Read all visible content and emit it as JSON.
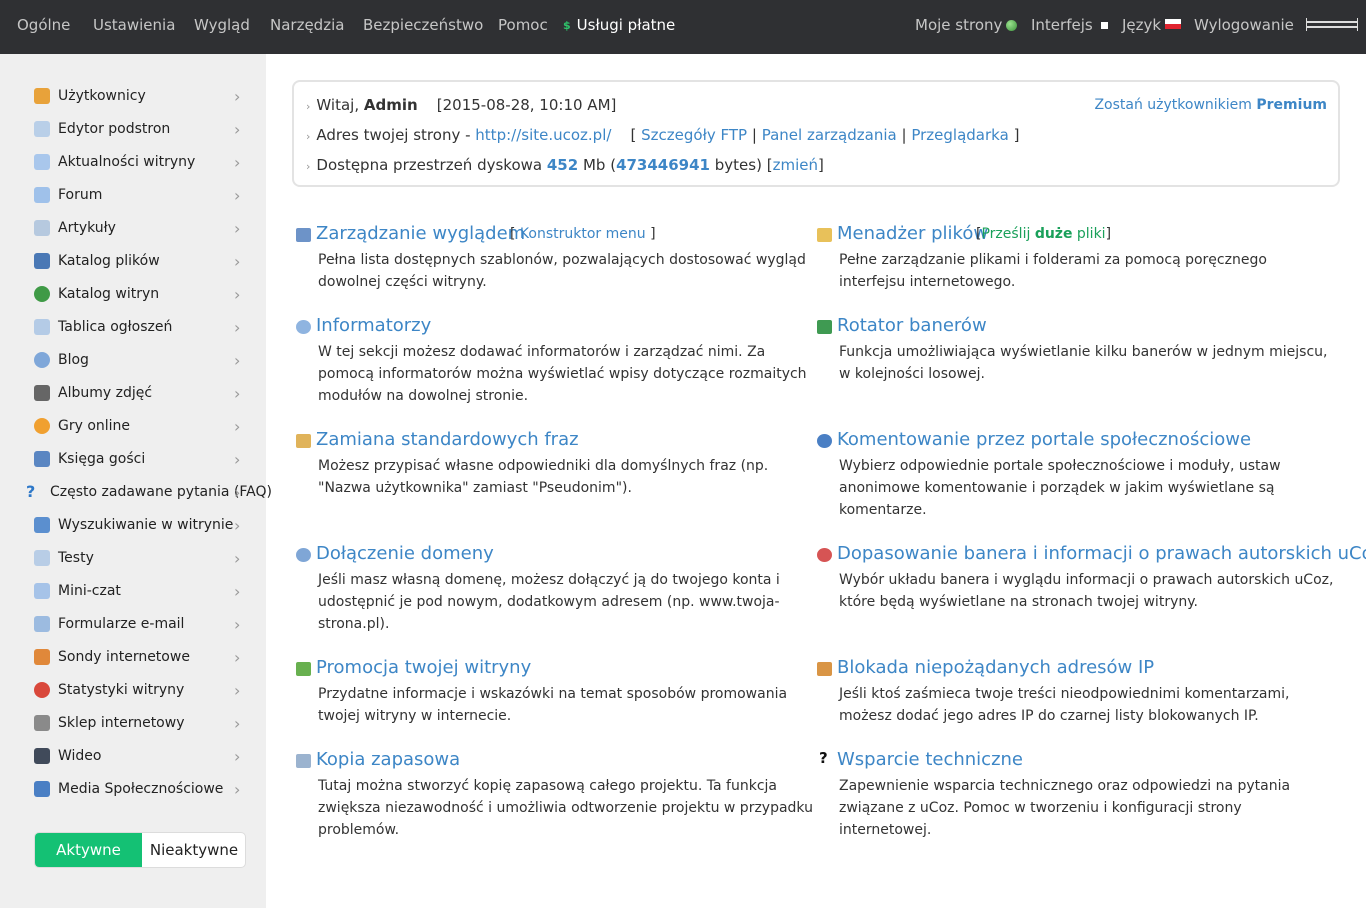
{
  "topnav": {
    "left": [
      "Ogólne",
      "Ustawienia",
      "Wygląd",
      "Narzędzia",
      "Bezpieczeństwo",
      "Pomoc"
    ],
    "paid": "Usługi płatne",
    "paid_icon": "$",
    "right": {
      "my_sites": "Moje strony",
      "interface": "Interfejs",
      "language": "Język",
      "logout": "Wylogowanie"
    }
  },
  "sidebar": {
    "items": [
      {
        "label": "Użytkownicy",
        "icon": "user-icon",
        "color": "#e8a23a"
      },
      {
        "label": "Edytor podstron",
        "icon": "page-icon",
        "color": "#b9cfe8"
      },
      {
        "label": "Aktualności witryny",
        "icon": "bulb-icon",
        "color": "#a9c7ec"
      },
      {
        "label": "Forum",
        "icon": "chat-icon",
        "color": "#9fc1ea"
      },
      {
        "label": "Artykuły",
        "icon": "article-icon",
        "color": "#b6c9df"
      },
      {
        "label": "Katalog plików",
        "icon": "floppy-icon",
        "color": "#4a78b5"
      },
      {
        "label": "Katalog witryn",
        "icon": "globe-icon",
        "color": "#3f9a46"
      },
      {
        "label": "Tablica ogłoszeń",
        "icon": "board-icon",
        "color": "#b4cbe6"
      },
      {
        "label": "Blog",
        "icon": "blog-icon",
        "color": "#7fa7d9"
      },
      {
        "label": "Albumy zdjęć",
        "icon": "camera-icon",
        "color": "#666666"
      },
      {
        "label": "Gry online",
        "icon": "game-icon",
        "color": "#f0a030"
      },
      {
        "label": "Księga gości",
        "icon": "book-icon",
        "color": "#5a86c2"
      },
      {
        "label": "Często zadawane pytania (FAQ)",
        "icon": "question-icon",
        "color": "#2e78c8"
      },
      {
        "label": "Wyszukiwanie w witrynie",
        "icon": "search-icon",
        "color": "#5b8fcf"
      },
      {
        "label": "Testy",
        "icon": "test-icon",
        "color": "#b8cde6"
      },
      {
        "label": "Mini-czat",
        "icon": "minichat-icon",
        "color": "#a6c3e8"
      },
      {
        "label": "Formularze e-mail",
        "icon": "mail-icon",
        "color": "#9cbbe0"
      },
      {
        "label": "Sondy internetowe",
        "icon": "poll-icon",
        "color": "#e0883a"
      },
      {
        "label": "Statystyki witryny",
        "icon": "stats-icon",
        "color": "#d9483b"
      },
      {
        "label": "Sklep internetowy",
        "icon": "cart-icon",
        "color": "#8a8a8a"
      },
      {
        "label": "Wideo",
        "icon": "video-icon",
        "color": "#404a5a"
      },
      {
        "label": "Media Społecznościowe",
        "icon": "social-icon",
        "color": "#4a7fc4"
      }
    ],
    "toggle": {
      "active": "Aktywne",
      "inactive": "Nieaktywne"
    }
  },
  "info": {
    "welcome_prefix": "Witaj,",
    "user": "Admin",
    "datetime": "[2015-08-28, 10:10 AM]",
    "premium_prefix": "Zostań użytkownikiem",
    "premium": "Premium",
    "address_label": "Adres twojej strony -",
    "address_url": "http://site.ucoz.pl/",
    "bracket_open": "[",
    "ftp": "Szczegóły FTP",
    "sep": "|",
    "panel": "Panel zarządzania",
    "browser": "Przeglądarka",
    "bracket_close": "]",
    "space_label": "Dostępna przestrzeń dyskowa",
    "space_mb": "452",
    "space_mb_unit": "Mb (",
    "space_bytes": "473446941",
    "space_bytes_unit": "bytes) [",
    "change": "zmień",
    "change_close": "]"
  },
  "sections": {
    "appearance": {
      "title": "Zarządzanie wyglądem",
      "extra_open": "[",
      "extra_link": "Konstruktor menu",
      "extra_close": "]",
      "desc": "Pełna lista dostępnych szablonów, pozwalających dostosować wygląd dowolnej części witryny."
    },
    "files": {
      "title": "Menadżer plików",
      "extra_open": "[",
      "extra_a": "Prześlij",
      "extra_b": "duże",
      "extra_c": "pliki",
      "extra_close": "]",
      "desc": "Pełne zarządzanie plikami i folderami za pomocą poręcznego interfejsu internetowego."
    },
    "informers": {
      "title": "Informatorzy",
      "desc": "W tej sekcji możesz dodawać informatorów i zarządzać nimi. Za pomocą informatorów można wyświetlać wpisy dotyczące rozmaitych modułów na dowolnej stronie."
    },
    "banners": {
      "title": "Rotator banerów",
      "desc": "Funkcja umożliwiająca wyświetlanie kilku banerów w jednym miejscu, w kolejności losowej."
    },
    "phrases": {
      "title": "Zamiana standardowych fraz",
      "desc": "Możesz przypisać własne odpowiedniki dla domyślnych fraz (np. \"Nazwa użytkownika\" zamiast \"Pseudonim\")."
    },
    "social_comments": {
      "title": "Komentowanie przez portale społecznościowe",
      "desc": "Wybierz odpowiednie portale społecznościowe i moduły, ustaw anonimowe komentowanie i porządek w jakim wyświetlane są komentarze."
    },
    "domain": {
      "title": "Dołączenie domeny",
      "desc": "Jeśli masz własną domenę, możesz dołączyć ją do twojego konta i udostępnić je pod nowym, dodatkowym adresem (np. www.twoja-strona.pl)."
    },
    "copyright": {
      "title": "Dopasowanie banera i informacji o prawach autorskich uCoz",
      "desc": "Wybór układu banera i wyglądu informacji o prawach autorskich uCoz, które będą wyświetlane na stronach twojej witryny."
    },
    "promotion": {
      "title": "Promocja twojej witryny",
      "desc": "Przydatne informacje i wskazówki na temat sposobów promowania twojej witryny w internecie."
    },
    "ipblock": {
      "title": "Blokada niepożądanych adresów IP",
      "desc": "Jeśli ktoś zaśmieca twoje treści nieodpowiednimi komentarzami, możesz dodać jego adres IP do czarnej listy blokowanych IP."
    },
    "backup": {
      "title": "Kopia zapasowa",
      "desc": "Tutaj można stworzyć kopię zapasową całego projektu. Ta funkcja zwiększa niezawodność i umożliwia odtworzenie projektu w przypadku problemów."
    },
    "support": {
      "title": "Wsparcie techniczne",
      "desc": "Zapewnienie wsparcia technicznego oraz odpowiedzi na pytania związane z uCoz. Pomoc w tworzeniu i konfiguracji strony internetowej."
    }
  },
  "colors": {
    "accent": "#3d86c6",
    "active_toggle": "#14c174",
    "topbar": "#2f3033",
    "sidebar": "#efefef"
  }
}
